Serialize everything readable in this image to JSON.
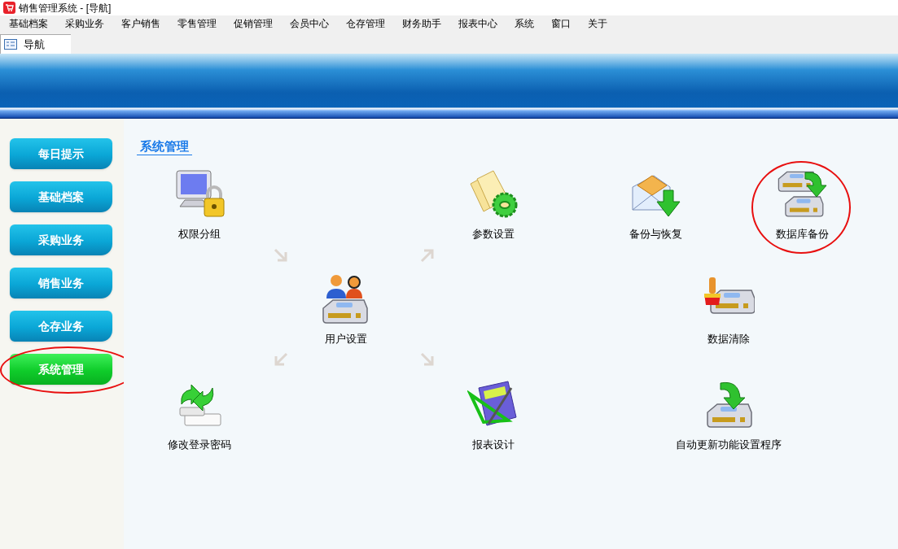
{
  "window": {
    "title": "销售管理系统 - [导航]"
  },
  "menu": [
    "基础档案",
    "采购业务",
    "客户销售",
    "零售管理",
    "促销管理",
    "会员中心",
    "仓存管理",
    "财务助手",
    "报表中心",
    "系统",
    "窗口",
    "关于"
  ],
  "tabs": [
    {
      "label": "导航",
      "selected": true
    }
  ],
  "sidebar": {
    "items": [
      {
        "label": "每日提示",
        "selected": false,
        "highlighted": false
      },
      {
        "label": "基础档案",
        "selected": false,
        "highlighted": false
      },
      {
        "label": "采购业务",
        "selected": false,
        "highlighted": false
      },
      {
        "label": "销售业务",
        "selected": false,
        "highlighted": false
      },
      {
        "label": "仓存业务",
        "selected": false,
        "highlighted": false
      },
      {
        "label": "系统管理",
        "selected": true,
        "highlighted": true
      }
    ]
  },
  "section": {
    "title": "系统管理",
    "items": [
      {
        "label": "权限分组",
        "kind": "monitor-lock",
        "highlighted": false
      },
      {
        "label": "参数设置",
        "kind": "papers-gear",
        "highlighted": false
      },
      {
        "label": "备份与恢复",
        "kind": "envelope-arrow",
        "highlighted": false
      },
      {
        "label": "数据库备份",
        "kind": "drives-arrow",
        "highlighted": true
      },
      {
        "label": "用户设置",
        "kind": "users-drive",
        "highlighted": false
      },
      {
        "label": "数据清除",
        "kind": "brush-drive",
        "highlighted": false
      },
      {
        "label": "修改登录密码",
        "kind": "arrows-field",
        "highlighted": false
      },
      {
        "label": "报表设计",
        "kind": "pad-ruler",
        "highlighted": false
      },
      {
        "label": "自动更新功能设置程序",
        "kind": "drive-arrow",
        "highlighted": false
      }
    ]
  }
}
